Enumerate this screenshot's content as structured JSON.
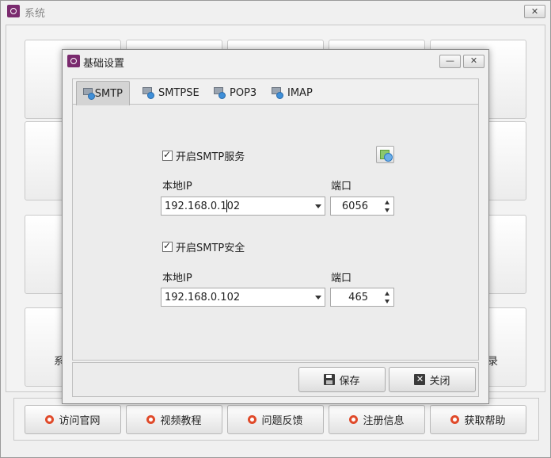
{
  "main_window": {
    "title": "系统",
    "close_glyph": "✕",
    "partial_tile_texts": [
      "系",
      "录"
    ],
    "bottom_buttons": [
      {
        "label": "访问官网",
        "icon": "circle-icon"
      },
      {
        "label": "视频教程",
        "icon": "circle-icon"
      },
      {
        "label": "问题反馈",
        "icon": "circle-icon"
      },
      {
        "label": "注册信息",
        "icon": "circle-icon"
      },
      {
        "label": "获取帮助",
        "icon": "circle-icon"
      }
    ]
  },
  "dialog": {
    "title": "基础设置",
    "minimize_glyph": "—",
    "close_glyph": "✕",
    "tabs": [
      {
        "label": "SMTP",
        "active": true
      },
      {
        "label": "SMTPSE",
        "active": false
      },
      {
        "label": "POP3",
        "active": false
      },
      {
        "label": "IMAP",
        "active": false
      }
    ],
    "smtp": {
      "enable_label": "开启SMTP服务",
      "enable_checked": true,
      "local_ip_label": "本地IP",
      "local_ip_value": "192.168.0.102",
      "port_label": "端口",
      "port_value": "6056",
      "secure_label": "开启SMTP安全",
      "secure_checked": true,
      "secure_ip_label": "本地IP",
      "secure_ip_value": "192.168.0.102",
      "secure_port_label": "端口",
      "secure_port_value": "465"
    },
    "buttons": {
      "save": "保存",
      "close": "关闭"
    }
  },
  "colors": {
    "app_icon": "#7a2a6e",
    "bottom_icon": "#e04a2a"
  }
}
